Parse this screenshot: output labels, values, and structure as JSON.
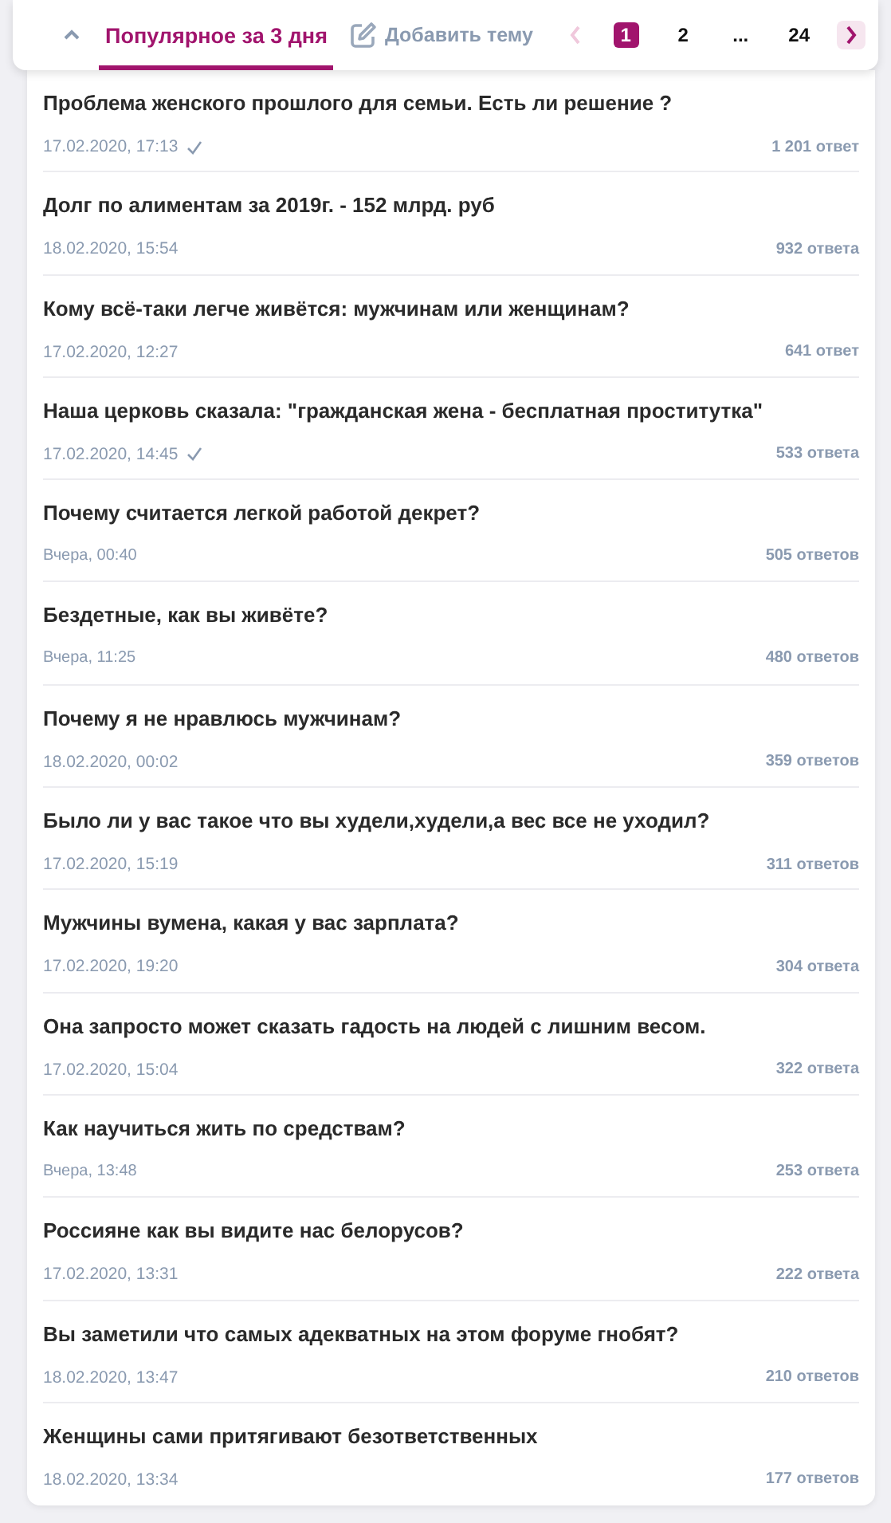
{
  "header": {
    "collapse_expanded": true,
    "tabs": [
      {
        "label": "Популярное за 3 дня",
        "selected": true
      }
    ],
    "add_topic": "Добавить тему",
    "pagination": {
      "prev_disabled": true,
      "next_disabled": false,
      "pages": [
        {
          "label": "1",
          "selected": true
        },
        {
          "label": "2",
          "selected": false
        },
        {
          "label": "...",
          "selected": false
        },
        {
          "label": "24",
          "selected": false
        }
      ]
    }
  },
  "topics": [
    {
      "title": "Проблема женского прошлого для семьи. Есть ли решение ?",
      "date": "17.02.2020, 17:13",
      "verified": true,
      "replies": "1 201 ответ"
    },
    {
      "title": "Долг по алиментам за 2019г. - 152 млрд. руб",
      "date": "18.02.2020, 15:54",
      "verified": false,
      "replies": "932 ответа"
    },
    {
      "title": "Кому всё-таки легче живётся: мужчинам или женщинам?",
      "date": "17.02.2020, 12:27",
      "verified": false,
      "replies": "641 ответ"
    },
    {
      "title": "Наша церковь сказала: \"гражданская жена - бесплатная проститутка\"",
      "date": "17.02.2020, 14:45",
      "verified": true,
      "replies": "533 ответа"
    },
    {
      "title": "Почему считается легкой работой декрет?",
      "date": "Вчера, 00:40",
      "verified": false,
      "replies": "505 ответов"
    },
    {
      "title": "Бездетные, как вы живёте?",
      "date": "Вчера, 11:25",
      "verified": false,
      "replies": "480 ответов"
    },
    {
      "title": "Почему я не нравлюсь мужчинам?",
      "date": "18.02.2020, 00:02",
      "verified": false,
      "replies": "359 ответов"
    },
    {
      "title": "Было ли у вас такое что вы худели,худели,а вес все не уходил?",
      "date": "17.02.2020, 15:19",
      "verified": false,
      "replies": "311 ответов"
    },
    {
      "title": "Мужчины вумена, какая у вас зарплата?",
      "date": "17.02.2020, 19:20",
      "verified": false,
      "replies": "304 ответа"
    },
    {
      "title": "Она запросто может сказать гадость на людей с лишним весом.",
      "date": "17.02.2020, 15:04",
      "verified": false,
      "replies": "322 ответа"
    },
    {
      "title": "Как научиться жить по средствам?",
      "date": "Вчера, 13:48",
      "verified": false,
      "replies": "253 ответа"
    },
    {
      "title": "Россияне как вы видите нас белорусов?",
      "date": "17.02.2020, 13:31",
      "verified": false,
      "replies": "222 ответа"
    },
    {
      "title": "Вы заметили что самых адекватных на этом форуме гнобят?",
      "date": "18.02.2020, 13:47",
      "verified": false,
      "replies": "210 ответов"
    },
    {
      "title": "Женщины сами притягивают безответственных",
      "date": "18.02.2020, 13:34",
      "verified": false,
      "replies": "177 ответов"
    }
  ]
}
